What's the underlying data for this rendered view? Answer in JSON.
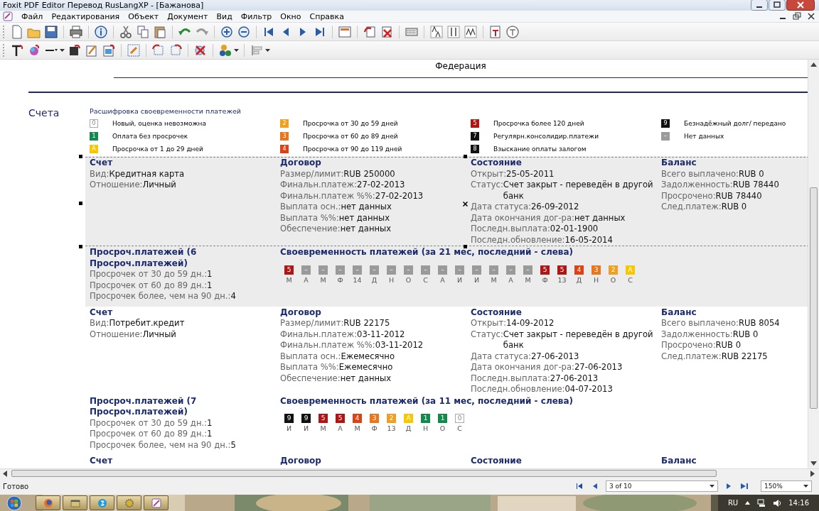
{
  "window": {
    "title": "Foxit PDF Editor Перевод RusLangXP - [Бажанова]"
  },
  "menu": [
    "Файл",
    "Редактирования",
    "Объект",
    "Документ",
    "Вид",
    "Фильтр",
    "Окно",
    "Справка"
  ],
  "document": {
    "heading": "Федерация",
    "section_title": "Счета",
    "legend": {
      "title": "Расшифровка своевременности платежей",
      "items": [
        {
          "code": "0",
          "label": "Новый, оценка невозможна",
          "color": "#ffffff"
        },
        {
          "code": "1",
          "label": "Оплата без просрочек",
          "color": "#138a4c"
        },
        {
          "code": "A",
          "label": "Просрочка от 1 до 29 дней",
          "color": "#f5c800"
        },
        {
          "code": "2",
          "label": "Просрочка от 30 до 59 дней",
          "color": "#f0a021"
        },
        {
          "code": "3",
          "label": "Просрочка от 60 до 89 дней",
          "color": "#e8761c"
        },
        {
          "code": "4",
          "label": "Просрочка от 90 до 119 дней",
          "color": "#dc4213"
        },
        {
          "code": "5",
          "label": "Просрочка более 120 дней",
          "color": "#b01515"
        },
        {
          "code": "7",
          "label": "Регулярн.консолидир.платежи",
          "color": "#111111"
        },
        {
          "code": "8",
          "label": "Взыскание оплаты залогом",
          "color": "#111111"
        },
        {
          "code": "9",
          "label": "Безнадёжный долг/ передано",
          "color": "#111111"
        },
        {
          "code": "–",
          "label": "Нет данных",
          "color": "#9a9a9a"
        }
      ]
    },
    "accounts": [
      {
        "selected": true,
        "columns": [
          {
            "title": "Счет",
            "fields": [
              {
                "label": "Вид:",
                "value": "Кредитная карта"
              },
              {
                "label": "Отношение:",
                "value": "Личный"
              }
            ]
          },
          {
            "title": "Договор",
            "fields": [
              {
                "label": "Размер/лимит:",
                "value": "RUB 250000"
              },
              {
                "label": "Финальн.платеж:",
                "value": "27-02-2013"
              },
              {
                "label": "Финальн.платеж %%:",
                "value": "27-02-2013"
              },
              {
                "label": "Выплата осн.:",
                "value": "нет данных"
              },
              {
                "label": "Выплата %%:",
                "value": "нет данных"
              },
              {
                "label": "Обеспечение:",
                "value": "нет данных"
              }
            ]
          },
          {
            "title": "Состояние",
            "fields": [
              {
                "label": "Открыт:",
                "value": "25-05-2011"
              },
              {
                "label": "Статус:",
                "value": "Счет закрыт - переведён в другой банк"
              },
              {
                "label": "Дата статуса:",
                "value": "26-09-2012"
              },
              {
                "label": "Дата окончания дог-ра:",
                "value": "нет данных"
              },
              {
                "label": "Последн.выплата:",
                "value": "02-01-1900"
              },
              {
                "label": "Последн.обновление:",
                "value": "16-05-2014"
              }
            ]
          },
          {
            "title": "Баланс",
            "fields": [
              {
                "label": "Всего выплачено:",
                "value": "RUB 0"
              },
              {
                "label": "Задолженность:",
                "value": "RUB 78440"
              },
              {
                "label": "Просрочено:",
                "value": "RUB 78440"
              },
              {
                "label": "След.платеж:",
                "value": "RUB 0"
              }
            ]
          }
        ],
        "overdue": {
          "title": "Просроч.платежей (6 Просроч.платежей)",
          "lines": [
            {
              "label": "Просрочек от 30 до 59 дн.:",
              "value": "1"
            },
            {
              "label": "Просрочек от 60 до 89 дн.:",
              "value": "1"
            },
            {
              "label": "Просрочек более, чем на 90 дн.:",
              "value": "4"
            }
          ]
        },
        "history": {
          "title": "Своевременность платежей (за 21 мес, последний - слева)",
          "cells": [
            {
              "code": "5",
              "month": "М",
              "color": "#b01515"
            },
            {
              "code": "–",
              "month": "А",
              "color": "#9a9a9a"
            },
            {
              "code": "–",
              "month": "М",
              "color": "#9a9a9a"
            },
            {
              "code": "–",
              "month": "Ф",
              "color": "#9a9a9a"
            },
            {
              "code": "–",
              "month": "14",
              "color": "#9a9a9a"
            },
            {
              "code": "–",
              "month": "Д",
              "color": "#9a9a9a"
            },
            {
              "code": "–",
              "month": "Н",
              "color": "#9a9a9a"
            },
            {
              "code": "–",
              "month": "О",
              "color": "#9a9a9a"
            },
            {
              "code": "–",
              "month": "С",
              "color": "#9a9a9a"
            },
            {
              "code": "–",
              "month": "А",
              "color": "#9a9a9a"
            },
            {
              "code": "–",
              "month": "И",
              "color": "#9a9a9a"
            },
            {
              "code": "–",
              "month": "И",
              "color": "#9a9a9a"
            },
            {
              "code": "–",
              "month": "М",
              "color": "#9a9a9a"
            },
            {
              "code": "–",
              "month": "А",
              "color": "#9a9a9a"
            },
            {
              "code": "–",
              "month": "М",
              "color": "#9a9a9a"
            },
            {
              "code": "5",
              "month": "Ф",
              "color": "#b01515"
            },
            {
              "code": "5",
              "month": "13",
              "color": "#b01515"
            },
            {
              "code": "4",
              "month": "Д",
              "color": "#dc4213"
            },
            {
              "code": "3",
              "month": "Н",
              "color": "#e8761c"
            },
            {
              "code": "2",
              "month": "О",
              "color": "#f0a021"
            },
            {
              "code": "A",
              "month": "С",
              "color": "#f5c800"
            }
          ]
        }
      },
      {
        "selected": false,
        "columns": [
          {
            "title": "Счет",
            "fields": [
              {
                "label": "Вид:",
                "value": "Потребит.кредит"
              },
              {
                "label": "Отношение:",
                "value": "Личный"
              }
            ]
          },
          {
            "title": "Договор",
            "fields": [
              {
                "label": "Размер/лимит:",
                "value": "RUB 22175"
              },
              {
                "label": "Финальн.платеж:",
                "value": "03-11-2012"
              },
              {
                "label": "Финальн.платеж %%:",
                "value": "03-11-2012"
              },
              {
                "label": "Выплата осн.:",
                "value": "Ежемесячно"
              },
              {
                "label": "Выплата %%:",
                "value": "Ежемесячно"
              },
              {
                "label": "Обеспечение:",
                "value": "нет данных"
              }
            ]
          },
          {
            "title": "Состояние",
            "fields": [
              {
                "label": "Открыт:",
                "value": "14-09-2012"
              },
              {
                "label": "Статус:",
                "value": "Счет закрыт - переведён в другой банк"
              },
              {
                "label": "Дата статуса:",
                "value": "27-06-2013"
              },
              {
                "label": "Дата окончания дог-ра:",
                "value": "27-06-2013"
              },
              {
                "label": "Последн.выплата:",
                "value": "27-06-2013"
              },
              {
                "label": "Последн.обновление:",
                "value": "04-07-2013"
              }
            ]
          },
          {
            "title": "Баланс",
            "fields": [
              {
                "label": "Всего выплачено:",
                "value": "RUB 8054"
              },
              {
                "label": "Задолженность:",
                "value": "RUB 0"
              },
              {
                "label": "Просрочено:",
                "value": "RUB 0"
              },
              {
                "label": "След.платеж:",
                "value": "RUB 22175"
              }
            ]
          }
        ],
        "overdue": {
          "title": "Просроч.платежей (7 Просроч.платежей)",
          "lines": [
            {
              "label": "Просрочек от 30 до 59 дн.:",
              "value": "1"
            },
            {
              "label": "Просрочек от 60 до 89 дн.:",
              "value": "1"
            },
            {
              "label": "Просрочек более, чем на 90 дн.:",
              "value": "5"
            }
          ]
        },
        "history": {
          "title": "Своевременность платежей (за 11 мес, последний - слева)",
          "cells": [
            {
              "code": "9",
              "month": "И",
              "color": "#111111"
            },
            {
              "code": "9",
              "month": "И",
              "color": "#111111"
            },
            {
              "code": "5",
              "month": "М",
              "color": "#b01515"
            },
            {
              "code": "5",
              "month": "А",
              "color": "#b01515"
            },
            {
              "code": "4",
              "month": "М",
              "color": "#dc4213"
            },
            {
              "code": "3",
              "month": "Ф",
              "color": "#e8761c"
            },
            {
              "code": "2",
              "month": "13",
              "color": "#f0a021"
            },
            {
              "code": "A",
              "month": "Д",
              "color": "#f5c800"
            },
            {
              "code": "1",
              "month": "Н",
              "color": "#138a4c"
            },
            {
              "code": "1",
              "month": "О",
              "color": "#138a4c"
            },
            {
              "code": "0",
              "month": "С",
              "color": "#ffffff"
            }
          ]
        }
      },
      {
        "selected": false,
        "columns": [
          {
            "title": "Счет"
          },
          {
            "title": "Договор"
          },
          {
            "title": "Состояние"
          },
          {
            "title": "Баланс"
          }
        ]
      }
    ]
  },
  "status_bar": {
    "text": "Готово",
    "page": "3 of 10",
    "zoom": "150%"
  },
  "taskbar": {
    "language": "RU",
    "time": "14:16"
  }
}
